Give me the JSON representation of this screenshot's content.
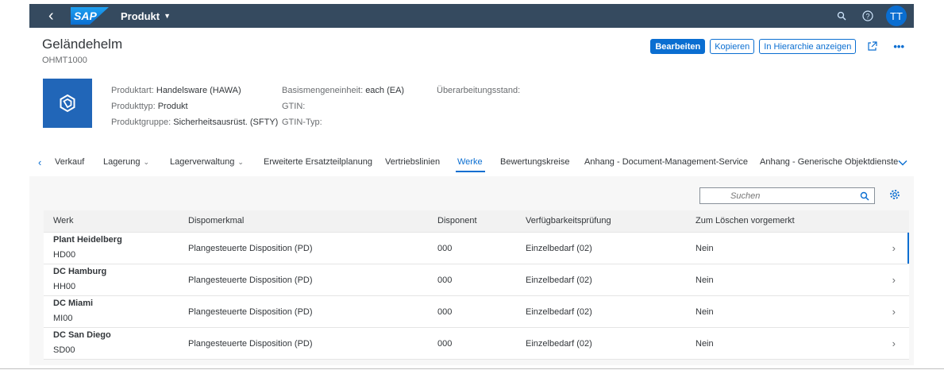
{
  "shell": {
    "logo": "SAP",
    "title": "Produkt",
    "avatar": "TT"
  },
  "header": {
    "title": "Geländehelm",
    "subtitle": "OHMT1000",
    "actions": {
      "edit": "Bearbeiten",
      "copy": "Kopieren",
      "hierarchy": "In Hierarchie anzeigen"
    },
    "attributes": {
      "col1": [
        {
          "label": "Produktart:",
          "value": "Handelsware (HAWA)"
        },
        {
          "label": "Produkttyp:",
          "value": "Produkt"
        },
        {
          "label": "Produktgruppe:",
          "value": "Sicherheitsausrüst. (SFTY)"
        }
      ],
      "col2": [
        {
          "label": "Basismengeneinheit:",
          "value": "each (EA)"
        },
        {
          "label": "GTIN:",
          "value": ""
        },
        {
          "label": "GTIN-Typ:",
          "value": ""
        }
      ],
      "col3": [
        {
          "label": "Überarbeitungsstand:",
          "value": ""
        }
      ]
    }
  },
  "tabs": [
    {
      "label": "Verkauf"
    },
    {
      "label": "Lagerung"
    },
    {
      "label": "Lagerverwaltung"
    },
    {
      "label": "Erweiterte Ersatzteilplanung"
    },
    {
      "label": "Vertriebslinien"
    },
    {
      "label": "Werke"
    },
    {
      "label": "Bewertungskreise"
    },
    {
      "label": "Anhang - Document-Management-Service"
    },
    {
      "label": "Anhang - Generische Objektdienste"
    }
  ],
  "search": {
    "placeholder": "Suchen"
  },
  "table": {
    "columns": [
      "Werk",
      "Dispomerkmal",
      "Disponent",
      "Verfügbarkeitsprüfung",
      "Zum Löschen vorgemerkt"
    ],
    "rows": [
      {
        "name": "Plant Heidelberg",
        "code": "HD00",
        "dispo": "Plangesteuerte Disposition (PD)",
        "disponent": "000",
        "check": "Einzelbedarf (02)",
        "delete": "Nein"
      },
      {
        "name": "DC Hamburg",
        "code": "HH00",
        "dispo": "Plangesteuerte Disposition (PD)",
        "disponent": "000",
        "check": "Einzelbedarf (02)",
        "delete": "Nein"
      },
      {
        "name": "DC Miami",
        "code": "MI00",
        "dispo": "Plangesteuerte Disposition (PD)",
        "disponent": "000",
        "check": "Einzelbedarf (02)",
        "delete": "Nein"
      },
      {
        "name": "DC San Diego",
        "code": "SD00",
        "dispo": "Plangesteuerte Disposition (PD)",
        "disponent": "000",
        "check": "Einzelbedarf (02)",
        "delete": "Nein"
      }
    ]
  }
}
